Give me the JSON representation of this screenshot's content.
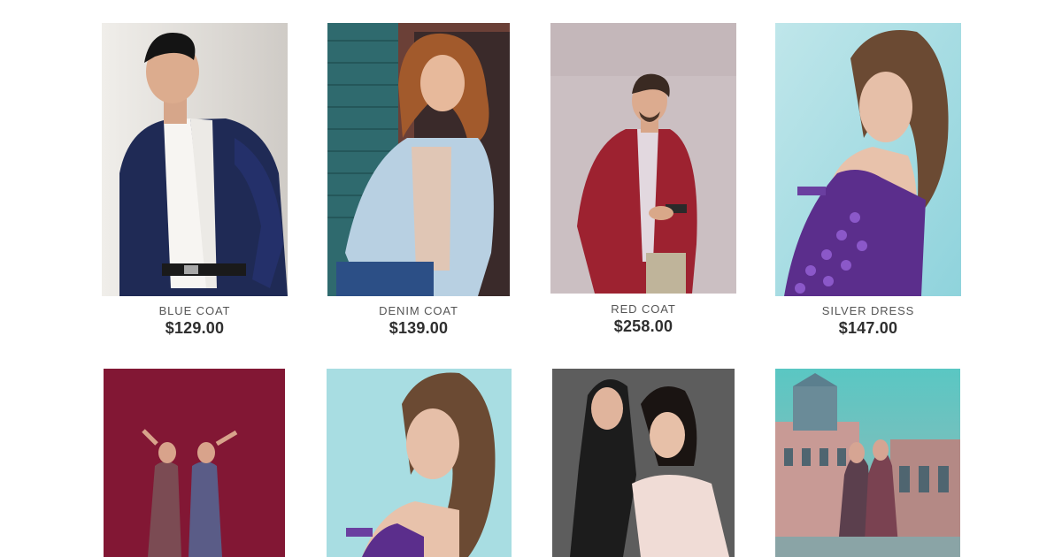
{
  "products": [
    {
      "name": "BLUE COAT",
      "price": "$129.00"
    },
    {
      "name": "DENIM COAT",
      "price": "$139.00"
    },
    {
      "name": "RED COAT",
      "price": "$258.00"
    },
    {
      "name": "SILVER DRESS",
      "price": "$147.00"
    },
    {
      "name": "",
      "price": ""
    },
    {
      "name": "",
      "price": ""
    },
    {
      "name": "",
      "price": ""
    },
    {
      "name": "",
      "price": ""
    }
  ],
  "colors": {
    "page_background": "#ffffff",
    "name_text": "#555555",
    "price_text": "#2f2f2f"
  }
}
